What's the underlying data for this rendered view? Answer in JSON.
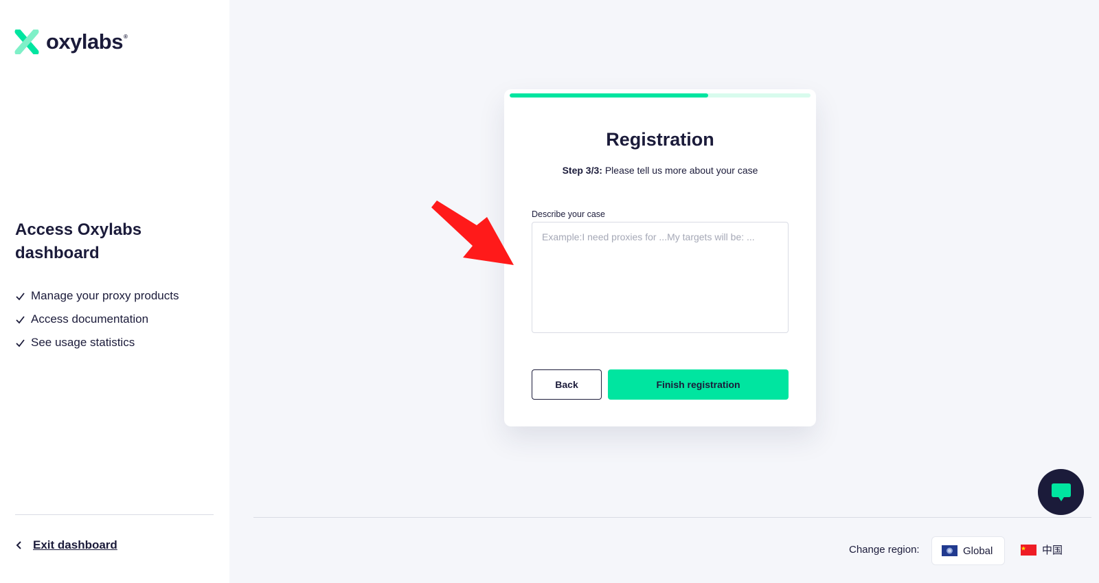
{
  "brand": {
    "name": "oxylabs",
    "registered_mark": "®",
    "accent": "#00e5a0",
    "dark": "#1b1b3a"
  },
  "sidebar": {
    "title": "Access Oxylabs dashboard",
    "features": [
      "Manage your proxy products",
      "Access documentation",
      "See usage statistics"
    ],
    "exit_label": "Exit dashboard"
  },
  "card": {
    "progress": 0.66,
    "title": "Registration",
    "step_label": "Step 3/3:",
    "step_text": "Please tell us more about your case",
    "field_label": "Describe your case",
    "field_value": "",
    "field_placeholder": "Example:I need proxies for ...My targets will be: ...",
    "back_label": "Back",
    "finish_label": "Finish registration"
  },
  "annotation": {
    "arrow_color": "#ff1a1a"
  },
  "footer": {
    "change_region_label": "Change region:",
    "regions": [
      {
        "name": "Global",
        "icon": "globe-flag-icon",
        "selected": true
      },
      {
        "name": "中国",
        "icon": "china-flag-icon",
        "selected": false
      }
    ]
  },
  "chat": {
    "icon": "chat-bubble-icon"
  }
}
